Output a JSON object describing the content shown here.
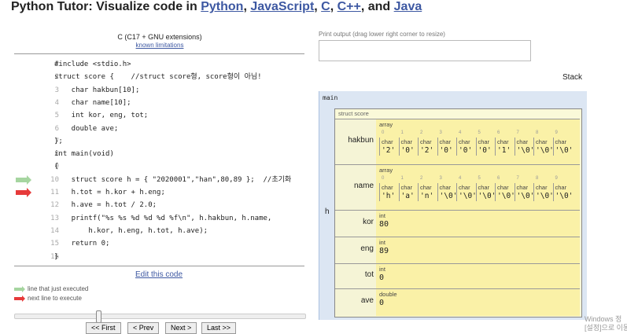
{
  "header": {
    "prefix": "Python Tutor: Visualize code in ",
    "langs": [
      "Python",
      "JavaScript",
      "C",
      "C++",
      "Java"
    ],
    "sep1": ", ",
    "sep2": ", ",
    "sep3": ", ",
    "sep4": ", and "
  },
  "editor": {
    "language_label": "C (C17 + GNU extensions)",
    "known_limitations": "known limitations",
    "lines": [
      {
        "num": "1",
        "text": "#include <stdio.h>",
        "arrow": ""
      },
      {
        "num": "2",
        "text": "struct score {    //struct score형, score형이 아님!",
        "arrow": ""
      },
      {
        "num": "3",
        "text": "    char hakbun[10];",
        "arrow": ""
      },
      {
        "num": "4",
        "text": "    char name[10];",
        "arrow": ""
      },
      {
        "num": "5",
        "text": "    int kor, eng, tot;",
        "arrow": ""
      },
      {
        "num": "6",
        "text": "    double ave;",
        "arrow": ""
      },
      {
        "num": "7",
        "text": "};",
        "arrow": ""
      },
      {
        "num": "8",
        "text": "int main(void)",
        "arrow": ""
      },
      {
        "num": "9",
        "text": "{",
        "arrow": ""
      },
      {
        "num": "10",
        "text": "    struct score h = { \"2020001\",\"han\",80,89 };  //초기화",
        "arrow": "green"
      },
      {
        "num": "11",
        "text": "    h.tot = h.kor + h.eng;",
        "arrow": "red"
      },
      {
        "num": "12",
        "text": "    h.ave = h.tot / 2.0;",
        "arrow": ""
      },
      {
        "num": "13",
        "text": "    printf(\"%s %s %d %d %d %f\\n\", h.hakbun, h.name,",
        "arrow": ""
      },
      {
        "num": "14",
        "text": "        h.kor, h.eng, h.tot, h.ave);",
        "arrow": ""
      },
      {
        "num": "15",
        "text": "    return 0;",
        "arrow": ""
      },
      {
        "num": "16",
        "text": "}",
        "arrow": ""
      }
    ],
    "edit_link": "Edit this code",
    "legend_green": "line that just executed",
    "legend_red": "next line to execute",
    "slider_progress": 0.28
  },
  "nav": {
    "first": "<< First",
    "prev": "< Prev",
    "next": "Next >",
    "last": "Last >>"
  },
  "output": {
    "label": "Print output (drag lower right corner to resize)"
  },
  "stack": {
    "label": "Stack",
    "frame_name": "main",
    "var_name": "h",
    "struct_label": "struct score",
    "fields": {
      "hakbun": {
        "name": "hakbun",
        "type": "array",
        "indices": [
          "0",
          "1",
          "2",
          "3",
          "4",
          "5",
          "6",
          "7",
          "8",
          "9"
        ],
        "cell_type": "char",
        "values": [
          "'2'",
          "'0'",
          "'2'",
          "'0'",
          "'0'",
          "'0'",
          "'1'",
          "'\\0'",
          "'\\0'",
          "'\\0'"
        ]
      },
      "name": {
        "name": "name",
        "type": "array",
        "indices": [
          "0",
          "1",
          "2",
          "3",
          "4",
          "5",
          "6",
          "7",
          "8",
          "9"
        ],
        "cell_type": "char",
        "values": [
          "'h'",
          "'a'",
          "'n'",
          "'\\0'",
          "'\\0'",
          "'\\0'",
          "'\\0'",
          "'\\0'",
          "'\\0'",
          "'\\0'"
        ]
      },
      "kor": {
        "name": "kor",
        "type": "int",
        "value": "80"
      },
      "eng": {
        "name": "eng",
        "type": "int",
        "value": "89"
      },
      "tot": {
        "name": "tot",
        "type": "int",
        "value": "0"
      },
      "ave": {
        "name": "ave",
        "type": "double",
        "value": "0"
      }
    }
  },
  "watermark": {
    "line1": "Windows 정",
    "line2": "[설정]으로 이동"
  },
  "colors": {
    "link": "#3D58A2",
    "green_arrow": "#a6d5a0",
    "red_arrow": "#e63a3a",
    "frame_bg": "#dce6f3",
    "cell_bg": "#faf1a7"
  }
}
